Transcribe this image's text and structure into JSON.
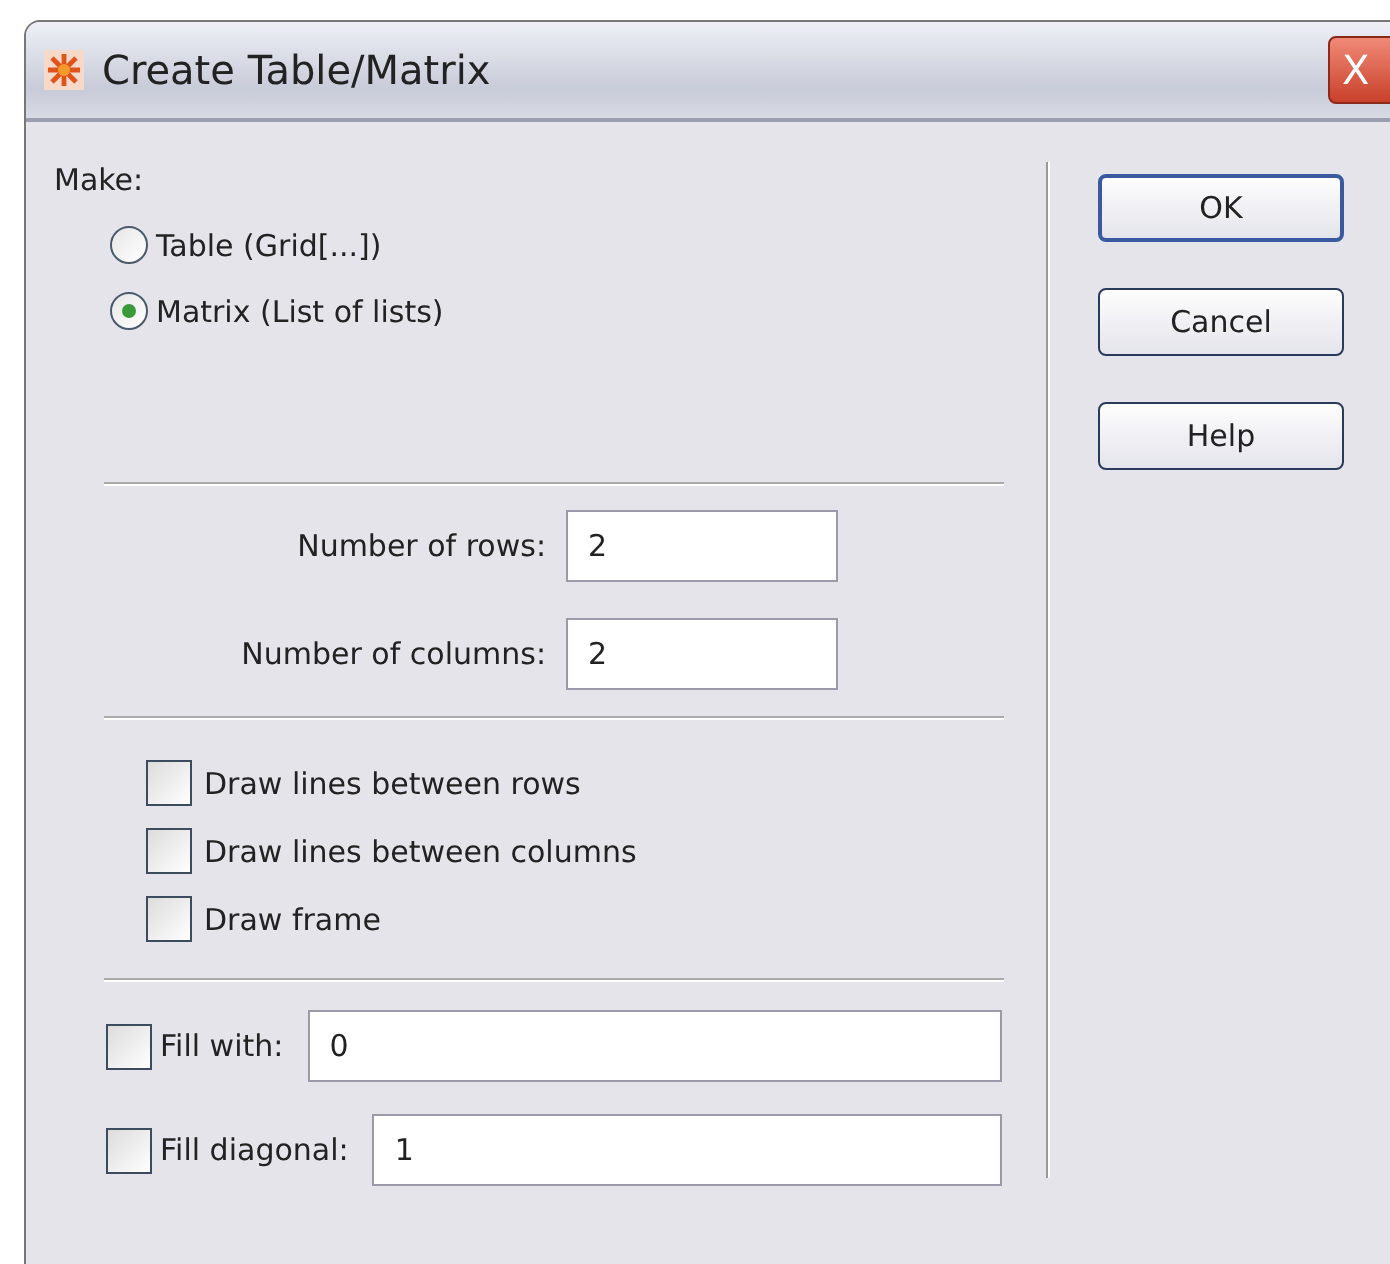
{
  "window": {
    "title": "Create Table/Matrix",
    "close_button": "X"
  },
  "make": {
    "label": "Make:",
    "options": [
      {
        "label": "Table (Grid[...])",
        "selected": false
      },
      {
        "label": "Matrix (List of lists)",
        "selected": true
      }
    ]
  },
  "fields": [
    {
      "label": "Number of rows:",
      "value": "2"
    },
    {
      "label": "Number of columns:",
      "value": "2"
    }
  ],
  "checkboxes": [
    {
      "label": "Draw lines between rows",
      "checked": false
    },
    {
      "label": "Draw lines between columns",
      "checked": false
    },
    {
      "label": "Draw frame",
      "checked": false
    }
  ],
  "fill_options": [
    {
      "label": "Fill with:",
      "checked": false,
      "value": "0"
    },
    {
      "label": "Fill diagonal:",
      "checked": false,
      "value": "1"
    }
  ],
  "buttons": [
    "OK",
    "Cancel",
    "Help"
  ]
}
